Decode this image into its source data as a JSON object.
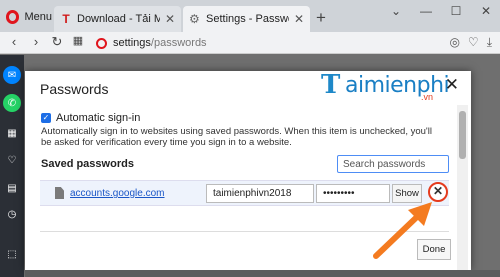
{
  "browser": {
    "menu_label": "Menu",
    "tabs": [
      {
        "title": "Download - Tải Miễn Phí VN",
        "active": false
      },
      {
        "title": "Settings - Passwords",
        "active": true
      }
    ],
    "url_host": "settings",
    "url_path": "/passwords",
    "accent_color": "#e0151d"
  },
  "sidebar": {
    "items": [
      {
        "icon": "messenger-icon",
        "color": "#0084ff"
      },
      {
        "icon": "whatsapp-icon",
        "color": "#25d366"
      },
      {
        "icon": "speed-dial-icon",
        "color": "#5a5f68"
      },
      {
        "icon": "bookmarks-icon",
        "color": "#5a5f68"
      },
      {
        "icon": "heart-icon",
        "color": "#5a5f68"
      },
      {
        "icon": "news-icon",
        "color": "#5a5f68"
      },
      {
        "icon": "history-icon",
        "color": "#5a5f68"
      },
      {
        "icon": "downloads-icon",
        "color": "#5a5f68"
      }
    ]
  },
  "dialog": {
    "title": "Passwords",
    "logo_text": "aimienphi",
    "logo_sub": ".vn",
    "auto_signin_label": "Automatic sign-in",
    "auto_signin_checked": true,
    "auto_signin_desc": "Automatically sign in to websites using saved passwords. When this item is unchecked, you'll be asked for verification every time you sign in to a website.",
    "saved_title": "Saved passwords",
    "search_placeholder": "Search passwords",
    "entries": [
      {
        "site": "accounts.google.com",
        "username": "taimienphivn2018",
        "password_mask": "•••••••••",
        "show_label": "Show"
      }
    ],
    "done_label": "Done"
  }
}
